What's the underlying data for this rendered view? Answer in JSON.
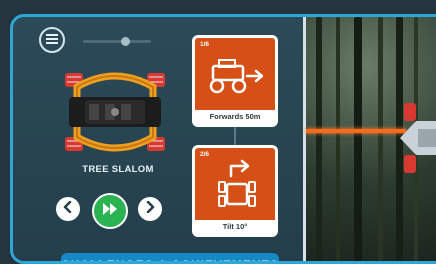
{
  "challenge": {
    "title": "TREE SLALOM"
  },
  "steps": [
    {
      "index": "1/6",
      "label": "Forwards 50m",
      "icon": "rover-forward-arrow-icon"
    },
    {
      "index": "2/6",
      "label": "Tilt 10°",
      "icon": "rover-tilt-arrow-icon"
    }
  ],
  "controls": {
    "menu_icon": "hamburger-menu-icon",
    "prev_icon": "chevron-left-icon",
    "play_icon": "fast-forward-icon",
    "next_icon": "chevron-right-icon"
  },
  "banner": {
    "text": "CHALLENGES & ACHIEVEMENTS"
  },
  "colors": {
    "frame_accent": "#2ea6d6",
    "step_card": "#d54f16",
    "play_button": "#2bb352",
    "laser": "#ff6a18"
  }
}
